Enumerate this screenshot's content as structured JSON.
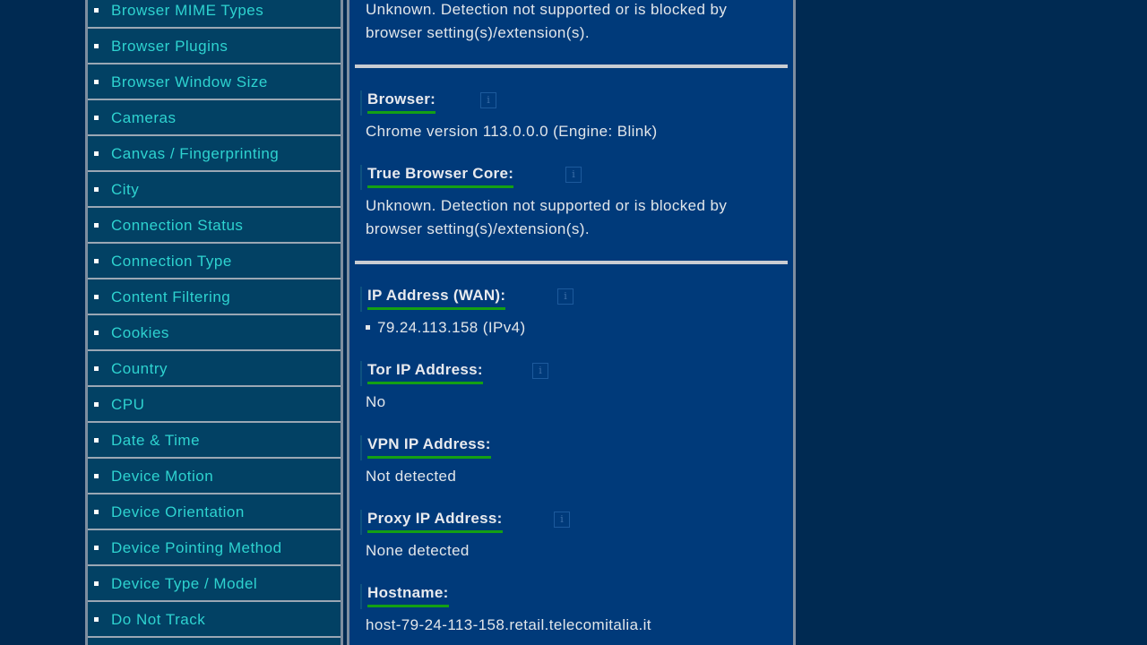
{
  "sidebar": {
    "items": [
      {
        "label": "Browser MIME Types"
      },
      {
        "label": "Browser Plugins"
      },
      {
        "label": "Browser Window Size"
      },
      {
        "label": "Cameras"
      },
      {
        "label": "Canvas / Fingerprinting"
      },
      {
        "label": "City"
      },
      {
        "label": "Connection Status"
      },
      {
        "label": "Connection Type"
      },
      {
        "label": "Content Filtering"
      },
      {
        "label": "Cookies"
      },
      {
        "label": "Country"
      },
      {
        "label": "CPU"
      },
      {
        "label": "Date & Time"
      },
      {
        "label": "Device Motion"
      },
      {
        "label": "Device Orientation"
      },
      {
        "label": "Device Pointing Method"
      },
      {
        "label": "Device Type / Model"
      },
      {
        "label": "Do Not Track"
      }
    ]
  },
  "content": {
    "top_text_line1": "Unknown. Detection not supported or is blocked by",
    "top_text_line2": "browser setting(s)/extension(s).",
    "browser": {
      "label": "Browser:",
      "value": "Chrome version 113.0.0.0 (Engine: Blink)"
    },
    "true_core": {
      "label": "True Browser Core:",
      "value_line1": "Unknown. Detection not supported or is blocked by",
      "value_line2": "browser setting(s)/extension(s)."
    },
    "ip_wan": {
      "label": "IP Address (WAN):",
      "value": "79.24.113.158  (IPv4)"
    },
    "tor": {
      "label": "Tor IP Address:",
      "value": "No"
    },
    "vpn": {
      "label": "VPN IP Address:",
      "value": "Not detected"
    },
    "proxy": {
      "label": "Proxy IP Address:",
      "value": "None detected"
    },
    "hostname": {
      "label": "Hostname:",
      "value": "host-79-24-113-158.retail.telecomitalia.it"
    },
    "info_icon_glyph": "i"
  },
  "colors": {
    "page_bg": "#002a52",
    "sidebar_bg": "#024164",
    "content_bg": "#003a7a",
    "link": "#2ed3d0",
    "underline": "#14a014"
  }
}
